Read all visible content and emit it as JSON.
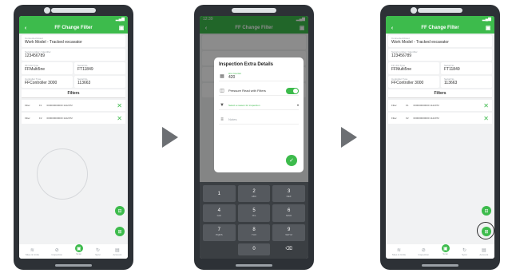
{
  "screen1": {
    "status": {
      "time": ""
    },
    "appbar": {
      "title": "FF Change Filter"
    },
    "work_model": {
      "label": "Connected Asset",
      "value": "Work Model - Tracked excavator"
    },
    "serial": {
      "label": "Serial number / Identifier",
      "value": "123456789"
    },
    "ff_unit": {
      "label": "FF Unit Type",
      "value": "FFMulti5ne"
    },
    "ff_serial": {
      "label": "Serial No.",
      "value": "FT11849"
    },
    "controller": {
      "label": "Controller Type",
      "value": "FFController 3000"
    },
    "ctrl_serial": {
      "label": "Serial No.",
      "value": "113663"
    },
    "filters_title": "Filters",
    "filter_rows": [
      {
        "name": "Filter",
        "code": "F1",
        "part": "000000000000 1122072"
      },
      {
        "name": "Filter",
        "code": "F2",
        "part": "000000000000 1122072"
      }
    ]
  },
  "screen2": {
    "status": {
      "time": "12:39"
    },
    "appbar": {
      "title": "FF Change Filter"
    },
    "dialog": {
      "title": "Inspection Extra Details",
      "hours_label": "Hrs Counter",
      "hours_value": "420",
      "pressure_label": "Pressure Read with Filters",
      "reason_label": "Select a reason for inspection",
      "notes_placeholder": "Notes"
    },
    "keypad": [
      {
        "d": "1",
        "s": ""
      },
      {
        "d": "2",
        "s": "ABC"
      },
      {
        "d": "3",
        "s": "DEF"
      },
      {
        "d": "4",
        "s": "GHI"
      },
      {
        "d": "5",
        "s": "JKL"
      },
      {
        "d": "6",
        "s": "MNO"
      },
      {
        "d": "7",
        "s": "PQRS"
      },
      {
        "d": "8",
        "s": "TUV"
      },
      {
        "d": "9",
        "s": "WXYZ"
      },
      {
        "d": "",
        "s": ""
      },
      {
        "d": "0",
        "s": ""
      },
      {
        "d": "⌫",
        "s": ""
      }
    ]
  },
  "nav": [
    {
      "icon": "home-icon",
      "glyph": "≋",
      "label": "Sites & Units"
    },
    {
      "icon": "check-icon",
      "glyph": "⊘",
      "label": "Inspection"
    },
    {
      "icon": "scan-icon",
      "glyph": "▣",
      "label": "Scan"
    },
    {
      "icon": "sync-icon",
      "glyph": "↻",
      "label": "Sync"
    },
    {
      "icon": "account-icon",
      "glyph": "▤",
      "label": "Account"
    }
  ],
  "colors": {
    "accent": "#3dbb4c",
    "phone": "#2d3136",
    "arrow": "#6c6f73"
  }
}
